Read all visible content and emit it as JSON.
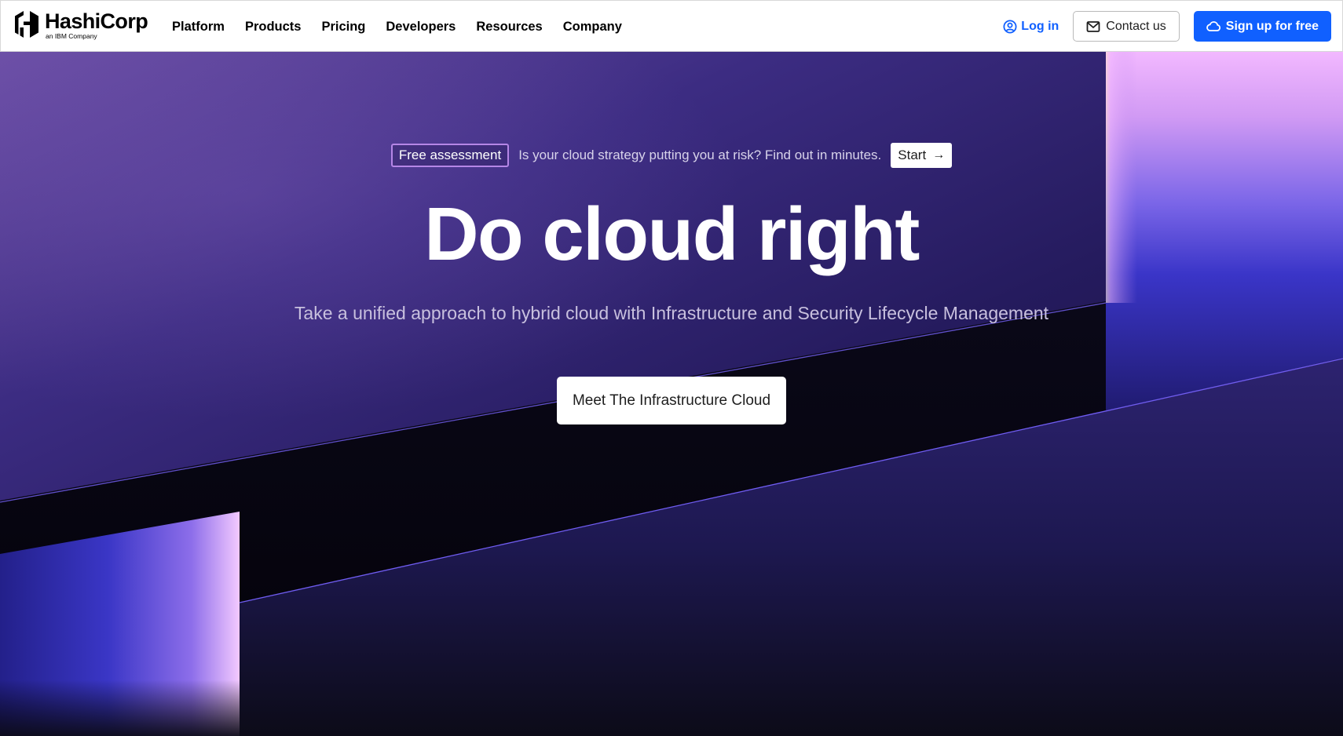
{
  "header": {
    "logo": {
      "wordmark": "HashiCorp",
      "tagline": "an IBM Company"
    },
    "nav": [
      "Platform",
      "Products",
      "Pricing",
      "Developers",
      "Resources",
      "Company"
    ],
    "login_label": "Log in",
    "contact_label": "Contact us",
    "signup_label": "Sign up for free"
  },
  "hero": {
    "banner": {
      "badge": "Free assessment",
      "text": "Is your cloud strategy putting you at risk? Find out in minutes.",
      "start_label": "Start",
      "arrow": "→"
    },
    "headline": "Do cloud right",
    "subheadline": "Take a unified approach to hybrid cloud with Infrastructure and Security Lifecycle Management",
    "cta_label": "Meet The Infrastructure Cloud"
  },
  "colors": {
    "brand_blue": "#1060ff",
    "badge_border": "#b586e6",
    "hero_purple": "#3b2b86"
  }
}
